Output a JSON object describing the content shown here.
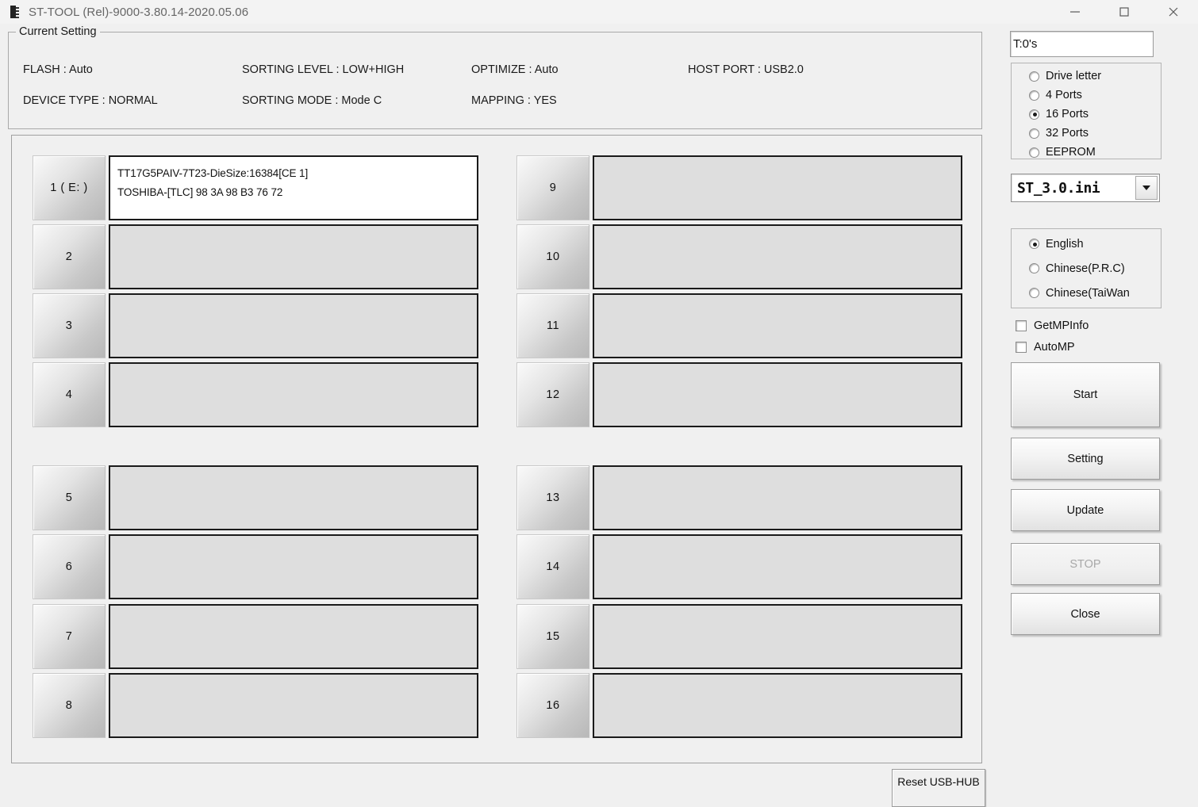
{
  "window": {
    "title": "ST-TOOL (Rel)-9000-3.80.14-2020.05.06",
    "icon": "chip-icon",
    "minimize_label": "—",
    "maximize_label": "□",
    "close_label": "×"
  },
  "current_setting": {
    "legend": "Current Setting",
    "items": [
      {
        "label": "FLASH : Auto"
      },
      {
        "label": "SORTING LEVEL : LOW+HIGH"
      },
      {
        "label": "OPTIMIZE : Auto"
      },
      {
        "label": "HOST PORT : USB2.0"
      },
      {
        "label": "DEVICE TYPE : NORMAL"
      },
      {
        "label": "SORTING MODE : Mode C"
      },
      {
        "label": "MAPPING : YES"
      }
    ]
  },
  "ports": [
    {
      "number": "1 ( E: )",
      "active": true,
      "line1": "TT17G5PAIV-7T23-DieSize:16384[CE 1]",
      "line2": "TOSHIBA-[TLC] 98 3A 98 B3 76 72"
    },
    {
      "number": "2",
      "active": false,
      "line1": "",
      "line2": ""
    },
    {
      "number": "3",
      "active": false,
      "line1": "",
      "line2": ""
    },
    {
      "number": "4",
      "active": false,
      "line1": "",
      "line2": ""
    },
    {
      "number": "5",
      "active": false,
      "line1": "",
      "line2": ""
    },
    {
      "number": "6",
      "active": false,
      "line1": "",
      "line2": ""
    },
    {
      "number": "7",
      "active": false,
      "line1": "",
      "line2": ""
    },
    {
      "number": "8",
      "active": false,
      "line1": "",
      "line2": ""
    },
    {
      "number": "9",
      "active": false,
      "line1": "",
      "line2": ""
    },
    {
      "number": "10",
      "active": false,
      "line1": "",
      "line2": ""
    },
    {
      "number": "11",
      "active": false,
      "line1": "",
      "line2": ""
    },
    {
      "number": "12",
      "active": false,
      "line1": "",
      "line2": ""
    },
    {
      "number": "13",
      "active": false,
      "line1": "",
      "line2": ""
    },
    {
      "number": "14",
      "active": false,
      "line1": "",
      "line2": ""
    },
    {
      "number": "15",
      "active": false,
      "line1": "",
      "line2": ""
    },
    {
      "number": "16",
      "active": false,
      "line1": "",
      "line2": ""
    }
  ],
  "bottom": {
    "reset_usb_hub_label": "Reset USB-HUB"
  },
  "sidebar": {
    "status_value": "T:0's",
    "mode_options": [
      {
        "label": "Drive letter",
        "selected": false
      },
      {
        "label": "4 Ports",
        "selected": false
      },
      {
        "label": "16 Ports",
        "selected": true
      },
      {
        "label": "32 Ports",
        "selected": false
      },
      {
        "label": "EEPROM",
        "selected": false
      }
    ],
    "ini_selected": "ST_3.0.ini",
    "language_options": [
      {
        "label": "English",
        "selected": true
      },
      {
        "label": "Chinese(P.R.C)",
        "selected": false
      },
      {
        "label": "Chinese(TaiWan",
        "selected": false
      }
    ],
    "checkboxes": [
      {
        "label": "GetMPInfo",
        "checked": false
      },
      {
        "label": "AutoMP",
        "checked": false
      }
    ],
    "buttons": {
      "start": {
        "label": "Start",
        "enabled": true
      },
      "setting": {
        "label": "Setting",
        "enabled": true
      },
      "update": {
        "label": "Update",
        "enabled": true
      },
      "stop": {
        "label": "STOP",
        "enabled": false
      },
      "close": {
        "label": "Close",
        "enabled": true
      }
    }
  }
}
